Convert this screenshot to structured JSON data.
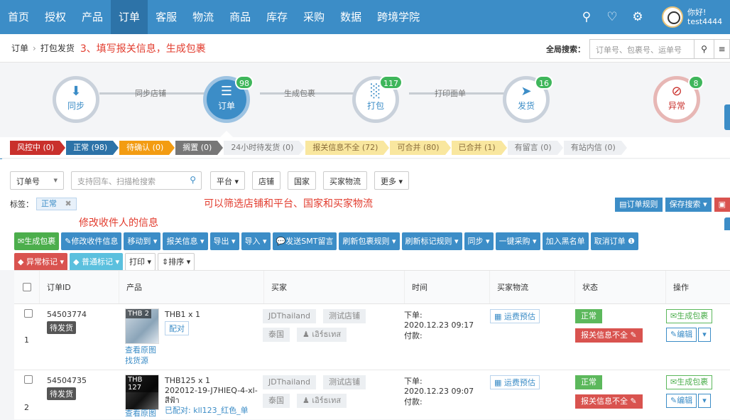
{
  "nav": {
    "items": [
      "首页",
      "授权",
      "产品",
      "订单",
      "客服",
      "物流",
      "商品",
      "库存",
      "采购",
      "数据",
      "跨境学院"
    ],
    "active_index": 3,
    "greeting": "你好!",
    "username": "test4444"
  },
  "breadcrumb": {
    "root": "订单",
    "current": "打包发货",
    "annotation": "3、填写报关信息，生成包裹"
  },
  "global_search": {
    "label": "全局搜索：",
    "placeholder": "订单号、包裹号、运单号"
  },
  "flow": {
    "steps": [
      {
        "label": "同步",
        "icon": "download-icon",
        "badge": ""
      },
      {
        "label": "订单",
        "icon": "list-icon",
        "badge": "98"
      },
      {
        "label": "打包",
        "icon": "barcode-icon",
        "badge": "117"
      },
      {
        "label": "发货",
        "icon": "send-icon",
        "badge": "16"
      },
      {
        "label": "异常",
        "icon": "eye-slash-icon",
        "badge": "8"
      }
    ],
    "connectors": [
      "同步店铺",
      "生成包裹",
      "打印面单"
    ]
  },
  "status_tabs": [
    {
      "label": "风控中 (0)",
      "style": "red"
    },
    {
      "label": "正常 (98)",
      "style": "blue"
    },
    {
      "label": "待确认 (0)",
      "style": "orange"
    },
    {
      "label": "搁置 (0)",
      "style": "grey"
    },
    {
      "label": "24小时待发货 (0)",
      "style": "light"
    },
    {
      "label": "报关信息不全 (72)",
      "style": "yellow"
    },
    {
      "label": "可合并 (80)",
      "style": "yellow"
    },
    {
      "label": "已合并 (1)",
      "style": "yellow"
    },
    {
      "label": "有留言 (0)",
      "style": "light"
    },
    {
      "label": "有站内信 (0)",
      "style": "light"
    }
  ],
  "filter": {
    "type_select": "订单号",
    "search_placeholder": "支持回车、扫描枪搜索",
    "buttons": [
      "平台",
      "店铺",
      "国家",
      "买家物流",
      "更多"
    ],
    "tag_label": "标签：",
    "tag_value": "正常",
    "annotation": "可以筛选店铺和平台、国家和买家物流",
    "rule_buttons": [
      "订单规则",
      "保存搜索"
    ]
  },
  "annotation_edit": "修改收件人的信息",
  "toolbar": {
    "row1": [
      "生成包裹",
      "修改收件信息",
      "移动到",
      "报关信息",
      "导出",
      "导入",
      "发送SMT留言",
      "刷新包裹规则",
      "刷新标记规则",
      "同步",
      "一键采购",
      "加入黑名单",
      "取消订单"
    ],
    "row2": [
      "异常标记",
      "普通标记",
      "打印",
      "排序"
    ]
  },
  "table": {
    "headers": [
      "订单ID",
      "产品",
      "买家",
      "时间",
      "买家物流",
      "状态",
      "操作"
    ],
    "rows": [
      {
        "index": "1",
        "order_id": "54503774",
        "order_status": "待发货",
        "thumb_price": "THB 2",
        "product": "THB1 x 1",
        "pair_btn": "配对",
        "view_img": "查看原图",
        "find_src": "找货源",
        "platform": "JDThailand",
        "shop": "测试店铺",
        "country": "泰国",
        "buyer": "เอิร์ธเทส",
        "time_order_label": "下单:",
        "time_order": "2020.12.23 09:17",
        "time_paid_label": "付款:",
        "fee": "运费预估",
        "status1": "正常",
        "status2": "报关信息不全",
        "op1": "生成包裹",
        "op2": "编辑"
      },
      {
        "index": "2",
        "order_id": "54504735",
        "order_status": "待发货",
        "thumb_price": "THB 127",
        "product": "THB125 x 1",
        "sku": "202012-19-J7HIEQ-4-xl-",
        "sku2": "สีฟ้า",
        "paired": "已配对: kll123_红色_单",
        "view_img": "查看原图",
        "platform": "JDThailand",
        "shop": "测试店铺",
        "country": "泰国",
        "buyer": "เอิร์ธเทส",
        "time_order_label": "下单:",
        "time_order": "2020.12.23 09:07",
        "time_paid_label": "付款:",
        "fee": "运费预估",
        "status1": "正常",
        "status2": "报关信息不全",
        "op1": "生成包裹",
        "op2": "编辑"
      }
    ]
  },
  "colors": {
    "primary": "#3c8dc7",
    "annotation": "#e23c2e",
    "success": "#5cb85c",
    "danger": "#d9534f"
  }
}
